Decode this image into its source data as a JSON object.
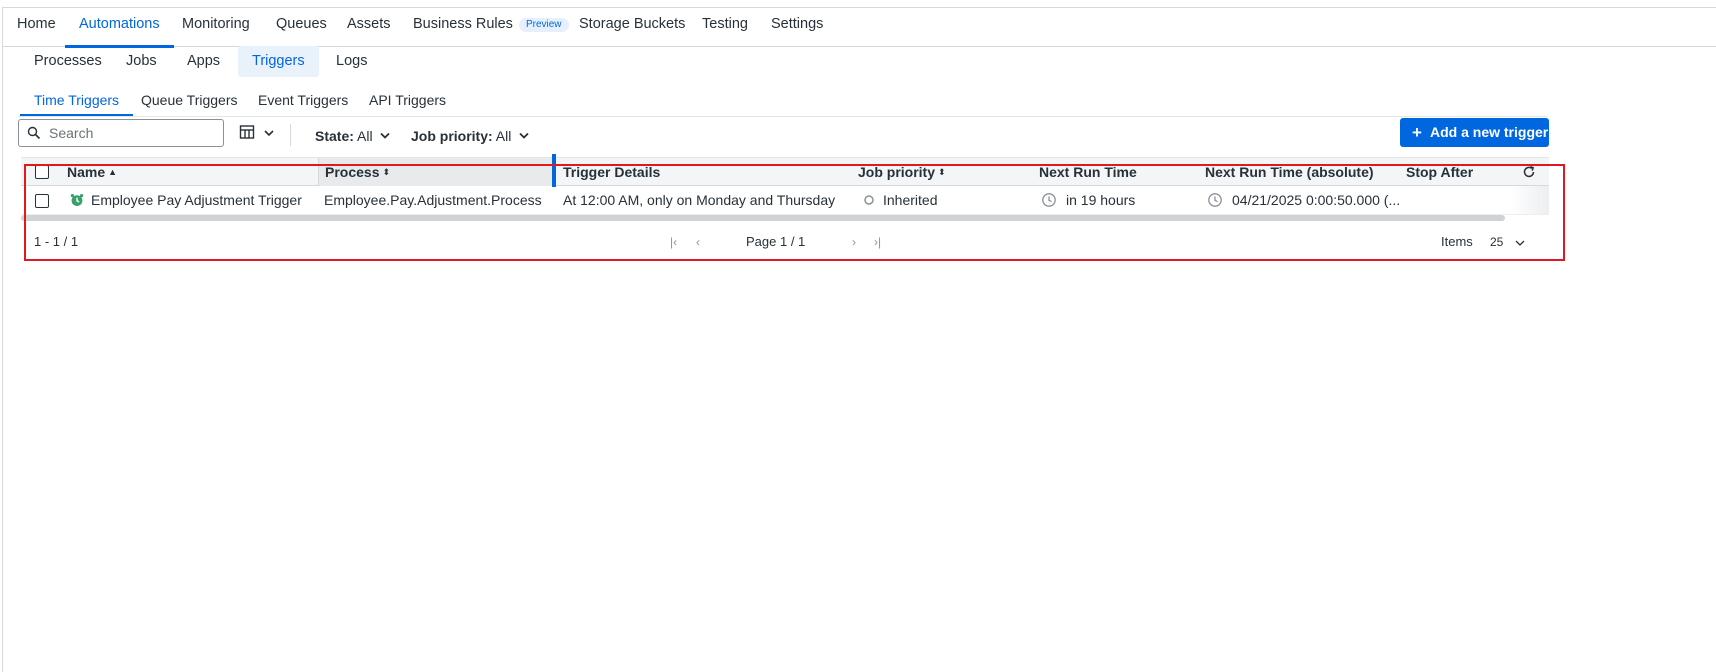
{
  "top_nav": {
    "items": [
      {
        "label": "Home"
      },
      {
        "label": "Automations",
        "active": true
      },
      {
        "label": "Monitoring"
      },
      {
        "label": "Queues"
      },
      {
        "label": "Assets"
      },
      {
        "label": "Business Rules",
        "badge": "Preview"
      },
      {
        "label": "Storage Buckets"
      },
      {
        "label": "Testing"
      },
      {
        "label": "Settings"
      }
    ]
  },
  "sub_tabs": [
    {
      "label": "Processes"
    },
    {
      "label": "Jobs"
    },
    {
      "label": "Apps"
    },
    {
      "label": "Triggers",
      "active": true
    },
    {
      "label": "Logs"
    }
  ],
  "trigger_tabs": [
    {
      "label": "Time Triggers",
      "active": true
    },
    {
      "label": "Queue Triggers"
    },
    {
      "label": "Event Triggers"
    },
    {
      "label": "API Triggers"
    }
  ],
  "toolbar": {
    "search_placeholder": "Search",
    "state_label": "State:",
    "state_value": "All",
    "priority_label": "Job priority:",
    "priority_value": "All",
    "add_button_plus": "+",
    "add_button_label": "Add a new trigger"
  },
  "grid": {
    "columns": [
      {
        "label": "Name",
        "sort": "▲"
      },
      {
        "label": "Process",
        "sort": "⬍"
      },
      {
        "label": "Trigger Details"
      },
      {
        "label": "Job priority",
        "sort": "⬍"
      },
      {
        "label": "Next Run Time"
      },
      {
        "label": "Next Run Time (absolute)"
      },
      {
        "label": "Stop After"
      }
    ],
    "rows": [
      {
        "name": "Employee Pay Adjustment Trigger",
        "process": "Employee.Pay.Adjustment.Process",
        "trigger_details": "At 12:00 AM, only on Monday and Thursday",
        "job_priority": "Inherited",
        "next_run_time": "in 19 hours",
        "next_run_time_absolute": "04/21/2025 0:00:50.000 (...",
        "stop_after": ""
      }
    ]
  },
  "footer": {
    "range": "1 - 1 / 1",
    "page": "Page 1 / 1",
    "items_label": "Items",
    "items_value": "25"
  },
  "colors": {
    "accent": "#0067df",
    "highlight": "#e0191f",
    "trigger_enabled": "#38a169"
  }
}
